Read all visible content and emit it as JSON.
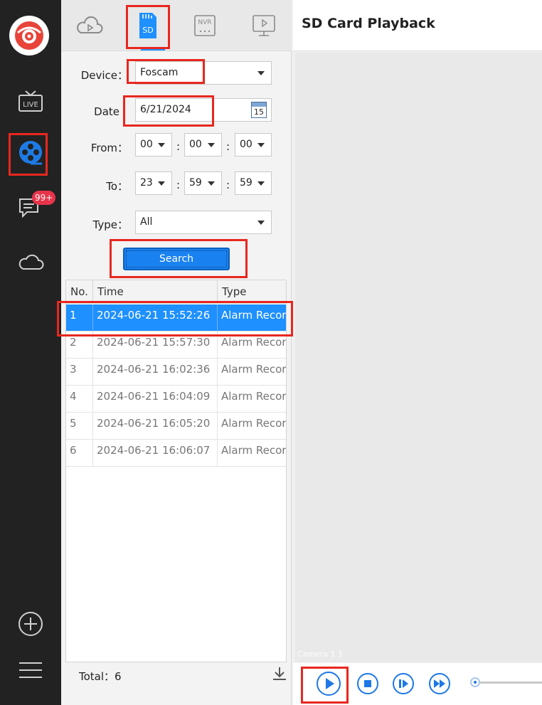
{
  "tabs": [
    "cloud-playback-icon",
    "sd-card-icon",
    "nvr-icon",
    "monitor-playback-icon"
  ],
  "sd_tab_label": "SD",
  "nvr_tab_label": "NVR",
  "nav": {
    "live_label": "LIVE",
    "messages_badge": "99+"
  },
  "filters": {
    "device_label": "Device：",
    "device_value": "Foscam",
    "date_label": "Date",
    "date_value": "6/21/2024",
    "calendar_day": "15",
    "from_label": "From：",
    "from_h": "00",
    "from_m": "00",
    "from_s": "00",
    "to_label": "To：",
    "to_h": "23",
    "to_m": "59",
    "to_s": "59",
    "colon": ":",
    "type_label": "Type：",
    "type_value": "All",
    "search_label": "Search"
  },
  "table": {
    "headers": [
      "No.",
      "Time",
      "Type"
    ],
    "rows": [
      {
        "no": "1",
        "time": "2024-06-21 15:52:26",
        "type": "Alarm Recor"
      },
      {
        "no": "2",
        "time": "2024-06-21 15:57:30",
        "type": "Alarm Recor"
      },
      {
        "no": "3",
        "time": "2024-06-21 16:02:36",
        "type": "Alarm Recor"
      },
      {
        "no": "4",
        "time": "2024-06-21 16:04:09",
        "type": "Alarm Recor"
      },
      {
        "no": "5",
        "time": "2024-06-21 16:05:20",
        "type": "Alarm Recor"
      },
      {
        "no": "6",
        "time": "2024-06-21 16:06:07",
        "type": "Alarm Recor"
      }
    ],
    "selected_row": 1
  },
  "total_label": "Total：6",
  "pane": {
    "title": "SD Card Playback",
    "camera_label": "Camera 1 1"
  },
  "colors": {
    "accent": "#1e90ff",
    "highlight": "#e8271f",
    "sidebar": "#222222",
    "badge": "#e8344a"
  }
}
